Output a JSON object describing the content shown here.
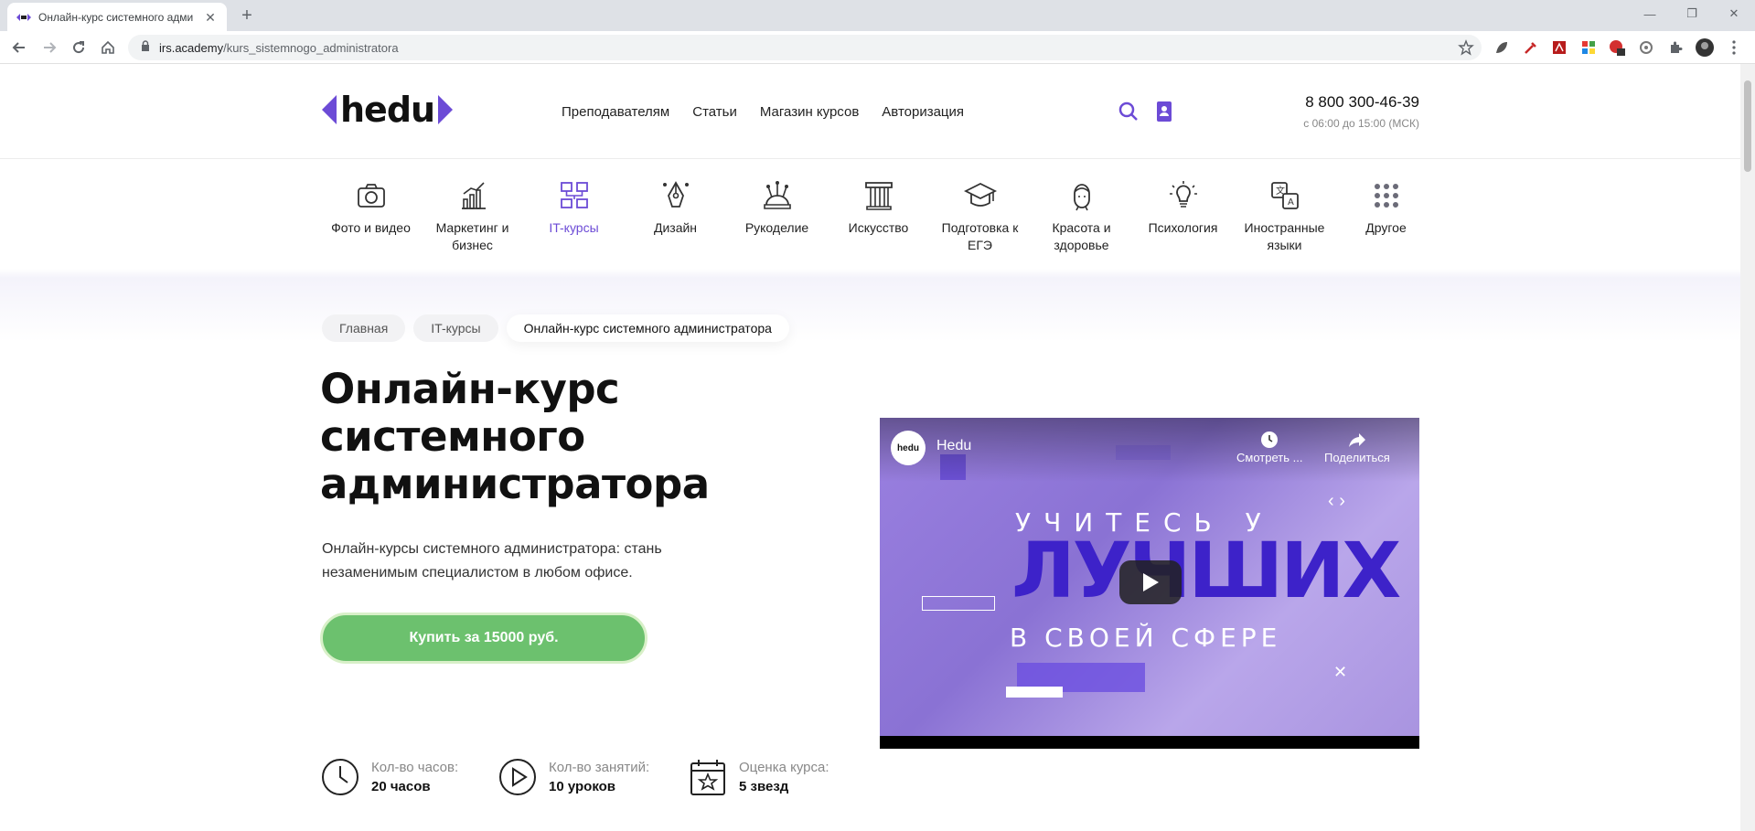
{
  "browser": {
    "tab_title": "Онлайн-курс системного адми",
    "url_domain": "irs.academy",
    "url_path": "/kurs_sistemnogo_administratora"
  },
  "header": {
    "logo_text": "hedu",
    "nav": [
      "Преподавателям",
      "Статьи",
      "Магазин курсов",
      "Авторизация"
    ],
    "phone": "8 800 300-46-39",
    "hours": "с 06:00 до 15:00 (МСК)"
  },
  "categories": [
    {
      "label": "Фото и видео",
      "icon": "camera-icon"
    },
    {
      "label": "Маркетинг и бизнес",
      "icon": "chart-icon"
    },
    {
      "label": "IT-курсы",
      "icon": "network-icon"
    },
    {
      "label": "Дизайн",
      "icon": "pen-tool-icon"
    },
    {
      "label": "Рукоделие",
      "icon": "pincushion-icon"
    },
    {
      "label": "Искусство",
      "icon": "column-icon"
    },
    {
      "label": "Подготовка к ЕГЭ",
      "icon": "graduation-cap-icon"
    },
    {
      "label": "Красота и здоровье",
      "icon": "face-icon"
    },
    {
      "label": "Психология",
      "icon": "lightbulb-icon"
    },
    {
      "label": "Иностранные языки",
      "icon": "translate-icon"
    },
    {
      "label": "Другое",
      "icon": "dots-grid-icon"
    }
  ],
  "active_category": "IT-курсы",
  "breadcrumbs": [
    "Главная",
    "IT-курсы",
    "Онлайн-курс системного администратора"
  ],
  "course": {
    "title": "Онлайн-курс системного администратора",
    "lead": "Онлайн-курсы системного администратора: стань незаменимым специалистом в любом офисе.",
    "buy_label": "Купить за 15000 руб."
  },
  "stats": [
    {
      "key": "Кол-во часов:",
      "value": "20 часов",
      "icon": "clock-icon"
    },
    {
      "key": "Кол-во занятий:",
      "value": "10 уроков",
      "icon": "play-circle-icon"
    },
    {
      "key": "Оценка курса:",
      "value": "5 звезд",
      "icon": "calendar-star-icon"
    }
  ],
  "video": {
    "channel_avatar": "hedu",
    "channel": "Hedu",
    "watch_later": "Смотреть ...",
    "share": "Поделиться",
    "line1": "УЧИТЕСЬ У",
    "line2": "ЛУЧШИХ",
    "line3": "В СВОЕЙ СФЕРЕ"
  },
  "colors": {
    "accent": "#6c4bd6",
    "buy_green": "#6cc16e",
    "video_purple": "#8a72d4"
  }
}
